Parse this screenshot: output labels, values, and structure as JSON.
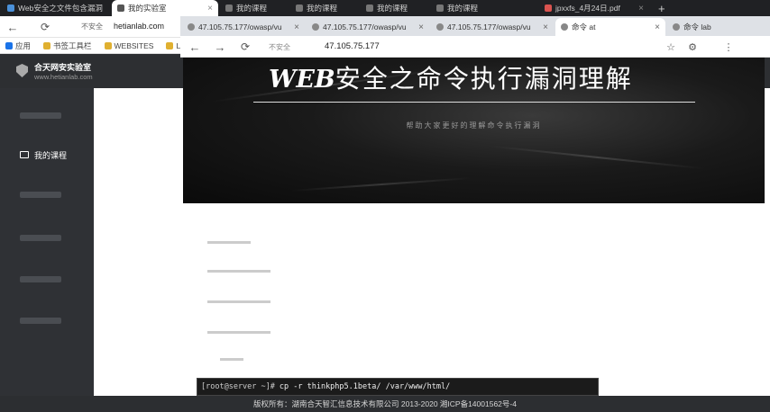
{
  "outer_tabs": [
    {
      "label": "Web安全之文件包含漏洞",
      "active": false
    },
    {
      "label": "我的实验室",
      "active": true
    },
    {
      "label": "我的课程",
      "active": false
    },
    {
      "label": "我的课程",
      "active": false
    },
    {
      "label": "我的课程",
      "active": false
    },
    {
      "label": "我的课程",
      "active": false
    },
    {
      "label": "jpxxfs_4月24日.pdf",
      "active": false
    }
  ],
  "outer_toolbar": {
    "security_label": "不安全",
    "url": "hetianlab.com"
  },
  "bookmarks": [
    {
      "label": "应用"
    },
    {
      "label": "书签工具栏"
    },
    {
      "label": "WEBSITES"
    },
    {
      "label": "LAB"
    }
  ],
  "site": {
    "brand_title": "合天网安实验室",
    "brand_url": "www.hetianlab.com"
  },
  "sidebar": {
    "items": [
      {
        "label": "我的课程",
        "active": true
      }
    ]
  },
  "inner_tabs": [
    {
      "label": "47.105.75.177/owasp/vu",
      "active": false
    },
    {
      "label": "47.105.75.177/owasp/vu",
      "active": false
    },
    {
      "label": "47.105.75.177/owasp/vu",
      "active": false
    },
    {
      "label": "命令 at",
      "active": true
    },
    {
      "label": "命令 lab",
      "active": false
    }
  ],
  "inner_toolbar": {
    "security_label": "不安全",
    "url": "47.105.75.177"
  },
  "banner": {
    "title_prefix": "WEB",
    "title": "安全之命令执行漏洞理解",
    "subtitle": "帮助大家更好的理解命令执行漏洞"
  },
  "terminal": {
    "prompt": "[root@server ~]#",
    "command": "cp -r thinkphp5.1beta/ /var/www/html/"
  },
  "footer": {
    "text": "版权所有：湖南合天智汇信息技术有限公司 2013-2020 湘ICP备14001562号-4"
  },
  "colors": {
    "chrome_dark": "#202124",
    "sidebar": "#2f3135",
    "banner_bg": "#0a0a0a",
    "footer": "#2c2e31"
  }
}
